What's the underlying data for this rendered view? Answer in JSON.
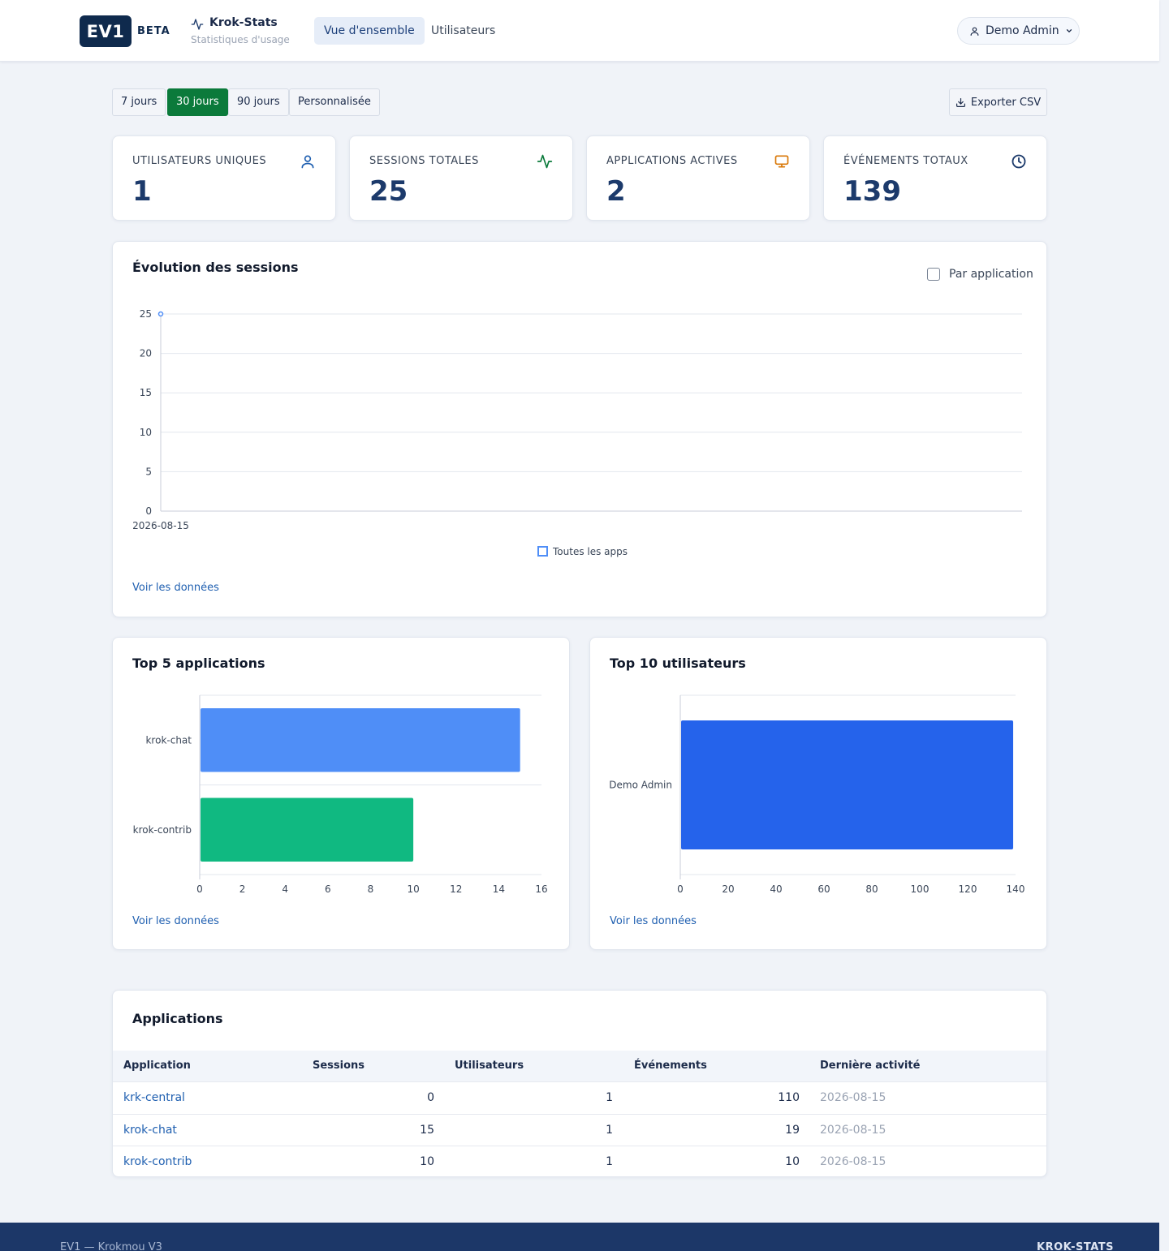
{
  "header": {
    "logo": "EV1",
    "beta": "BETA",
    "brand_title": "Krok-Stats",
    "brand_subtitle": "Statistiques d'usage",
    "nav": [
      {
        "label": "Vue d'ensemble",
        "active": true
      },
      {
        "label": "Utilisateurs",
        "active": false
      }
    ],
    "user": "Demo Admin"
  },
  "periods": [
    {
      "label": "7 jours",
      "active": false
    },
    {
      "label": "30 jours",
      "active": true
    },
    {
      "label": "90 jours",
      "active": false
    },
    {
      "label": "Personnalisée",
      "active": false
    }
  ],
  "export_label": "Exporter CSV",
  "stats": [
    {
      "label": "UTILISATEURS UNIQUES",
      "value": "1",
      "icon": "user-icon",
      "color": "#1f5fb0"
    },
    {
      "label": "SESSIONS TOTALES",
      "value": "25",
      "icon": "activity-icon",
      "color": "#0b7a3b"
    },
    {
      "label": "APPLICATIONS ACTIVES",
      "value": "2",
      "icon": "monitor-icon",
      "color": "#d97706"
    },
    {
      "label": "ÉVÉNEMENTS TOTAUX",
      "value": "139",
      "icon": "clock-icon",
      "color": "#1c3a6b"
    }
  ],
  "sessions_chart": {
    "title": "Évolution des sessions",
    "checkbox_label": "Par application",
    "link": "Voir les données"
  },
  "top_apps": {
    "title": "Top 5 applications",
    "link": "Voir les données"
  },
  "top_users": {
    "title": "Top 10 utilisateurs",
    "link": "Voir les données"
  },
  "chart_data": [
    {
      "type": "line",
      "x": [
        "2026-08-15"
      ],
      "series": [
        {
          "name": "Toutes les apps",
          "values": [
            25
          ],
          "color": "#4f8ef7"
        }
      ],
      "ylim": [
        0,
        25
      ],
      "yticks": [
        0,
        5,
        10,
        15,
        20,
        25
      ],
      "grid": true,
      "legend": "bottom"
    },
    {
      "type": "bar",
      "orientation": "horizontal",
      "categories": [
        "krok-chat",
        "krok-contrib"
      ],
      "values": [
        15,
        10
      ],
      "colors": [
        "#4f8ef7",
        "#10b981"
      ],
      "xlim": [
        0,
        16
      ],
      "xticks": [
        0,
        2,
        4,
        6,
        8,
        10,
        12,
        14,
        16
      ]
    },
    {
      "type": "bar",
      "orientation": "horizontal",
      "categories": [
        "Demo Admin"
      ],
      "values": [
        139
      ],
      "colors": [
        "#2563eb"
      ],
      "xlim": [
        0,
        140
      ],
      "xticks": [
        0,
        20,
        40,
        60,
        80,
        100,
        120,
        140
      ]
    }
  ],
  "table": {
    "title": "Applications",
    "columns": [
      "Application",
      "Sessions",
      "Utilisateurs",
      "Événements",
      "Dernière activité"
    ],
    "rows": [
      {
        "app": "krk-central",
        "sessions": "0",
        "users": "1",
        "events": "110",
        "last": "2026-08-15"
      },
      {
        "app": "krok-chat",
        "sessions": "15",
        "users": "1",
        "events": "19",
        "last": "2026-08-15"
      },
      {
        "app": "krok-contrib",
        "sessions": "10",
        "users": "1",
        "events": "10",
        "last": "2026-08-15"
      }
    ]
  },
  "footer": {
    "left": "EV1 — Krokmou V3",
    "right": "KROK-STATS"
  }
}
